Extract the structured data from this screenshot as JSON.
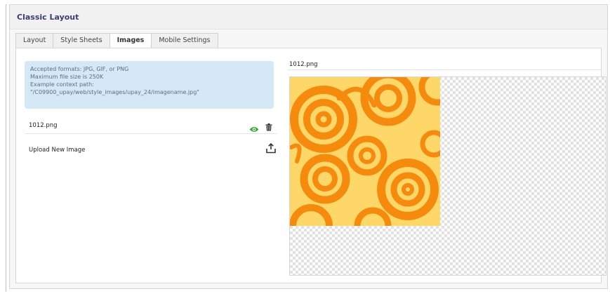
{
  "panel": {
    "title": "Classic Layout"
  },
  "tabs": [
    {
      "label": "Layout"
    },
    {
      "label": "Style Sheets"
    },
    {
      "label": "Images"
    },
    {
      "label": "Mobile Settings"
    }
  ],
  "info": {
    "line1": "Accepted formats: JPG, GIF, or PNG",
    "line2": "Maximum file size is 250K",
    "line3": "Example context path:",
    "line4": "\"/C09900_upay/web/style_images/upay_24/imagename.jpg\""
  },
  "files": [
    {
      "name": "1012.png"
    }
  ],
  "upload": {
    "label": "Upload New Image"
  },
  "preview": {
    "filename": "1012.png"
  },
  "colors": {
    "swirl_bg": "#fdd868",
    "swirl_orange": "#f58a0c",
    "eye_green": "#3ea83a"
  },
  "icons": {
    "view": "eye-icon",
    "delete": "trash-icon",
    "upload": "upload-icon"
  }
}
